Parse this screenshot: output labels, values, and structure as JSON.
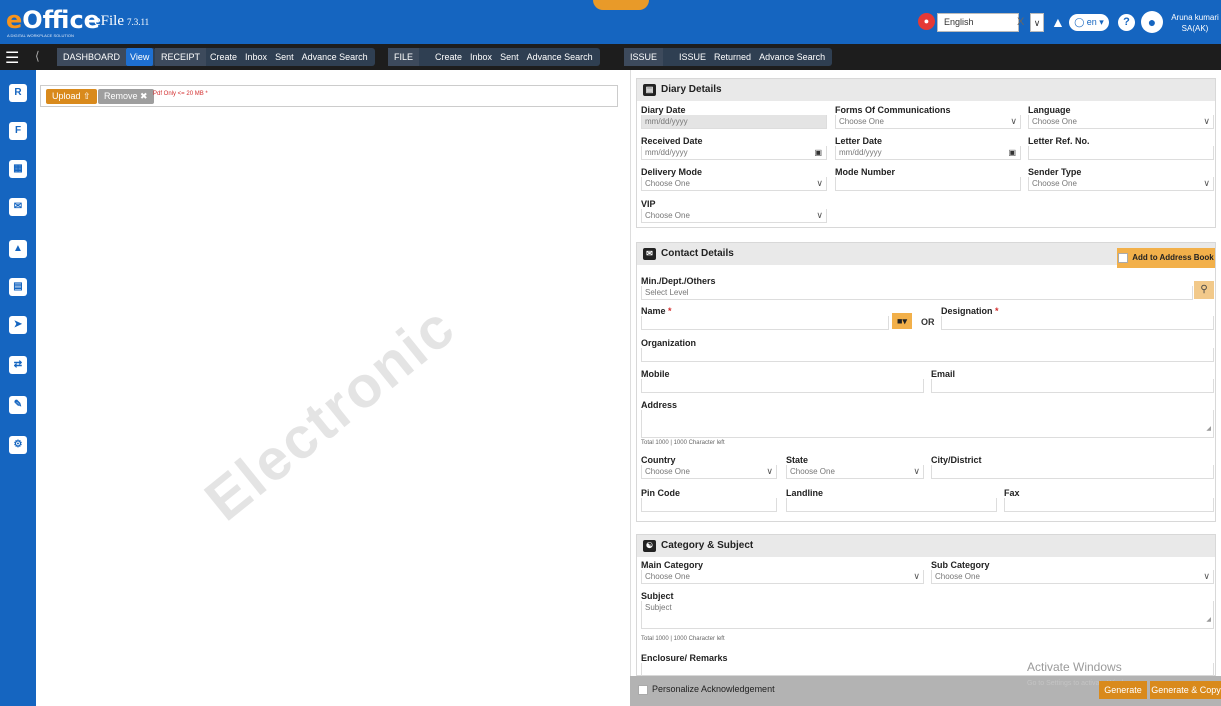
{
  "app": {
    "logo_e": "e",
    "logo_rest": "Office",
    "tagline": "A DIGITAL WORKPLACE SOLUTION",
    "name": "eFile",
    "version": "7.3.11"
  },
  "header": {
    "language_value": "English",
    "language_clear": "X",
    "lang_short": "en",
    "help_label": "?",
    "user_name": "Aruna kumari",
    "user_role": "SA(AK)"
  },
  "nav": {
    "dashboard": {
      "label": "DASHBOARD",
      "items": [
        "View"
      ]
    },
    "receipt": {
      "label": "RECEIPT",
      "items": [
        "Create",
        "Inbox",
        "Sent",
        "Advance Search"
      ]
    },
    "file": {
      "label": "FILE",
      "items": [
        "Create",
        "Inbox",
        "Sent",
        "Advance Search"
      ]
    },
    "issue": {
      "label": "ISSUE",
      "items": [
        "ISSUE",
        "Returned",
        "Advance Search"
      ]
    }
  },
  "sidebar": {
    "icons": [
      "receipt-icon",
      "file-icon",
      "calendar-icon",
      "mail-icon",
      "dispatch-icon",
      "notes-icon",
      "sent-icon",
      "transfer-icon",
      "report-icon",
      "settings-icon"
    ]
  },
  "upload": {
    "upload_label": "Upload",
    "remove_label": "Remove",
    "note": "Pdf Only <= 20 MB *",
    "watermark": "Electronic"
  },
  "diary": {
    "title": "Diary Details",
    "diary_date": {
      "label": "Diary Date",
      "placeholder": "mm/dd/yyyy"
    },
    "forms_of_comm": {
      "label": "Forms Of Communications",
      "value": "Choose One"
    },
    "language": {
      "label": "Language",
      "value": "Choose One"
    },
    "received_date": {
      "label": "Received Date",
      "placeholder": "mm/dd/yyyy"
    },
    "letter_date": {
      "label": "Letter Date",
      "placeholder": "mm/dd/yyyy"
    },
    "letter_ref": {
      "label": "Letter Ref. No.",
      "value": ""
    },
    "delivery_mode": {
      "label": "Delivery Mode",
      "value": "Choose One"
    },
    "mode_number": {
      "label": "Mode Number",
      "value": ""
    },
    "sender_type": {
      "label": "Sender Type",
      "value": "Choose One"
    },
    "vip": {
      "label": "VIP",
      "value": "Choose One"
    }
  },
  "contact": {
    "title": "Contact Details",
    "add_book": "Add to Address Book",
    "ministry": {
      "label": "Min./Dept./Others",
      "placeholder": "Select Level"
    },
    "name": {
      "label": "Name",
      "required": "*"
    },
    "or": "OR",
    "designation": {
      "label": "Designation",
      "required": "*"
    },
    "organization": {
      "label": "Organization"
    },
    "mobile": {
      "label": "Mobile"
    },
    "email": {
      "label": "Email"
    },
    "address": {
      "label": "Address"
    },
    "addr_count": "Total 1000 | 1000 Character left",
    "country": {
      "label": "Country",
      "value": "Choose One"
    },
    "state": {
      "label": "State",
      "value": "Choose One"
    },
    "city": {
      "label": "City/District"
    },
    "pincode": {
      "label": "Pin Code"
    },
    "landline": {
      "label": "Landline"
    },
    "fax": {
      "label": "Fax"
    }
  },
  "category": {
    "title": "Category & Subject",
    "main_category": {
      "label": "Main Category",
      "value": "Choose One"
    },
    "sub_category": {
      "label": "Sub Category",
      "value": "Choose One"
    },
    "subject": {
      "label": "Subject",
      "placeholder": "Subject"
    },
    "subj_count": "Total 1000 | 1000 Character left",
    "enclosure": {
      "label": "Enclosure/ Remarks"
    }
  },
  "footer": {
    "personalize": "Personalize Acknowledgement",
    "generate": "Generate",
    "generate_copy": "Generate & Copy",
    "activate_title": "Activate Windows",
    "activate_sub": "Go to Settings to activate Windows."
  }
}
